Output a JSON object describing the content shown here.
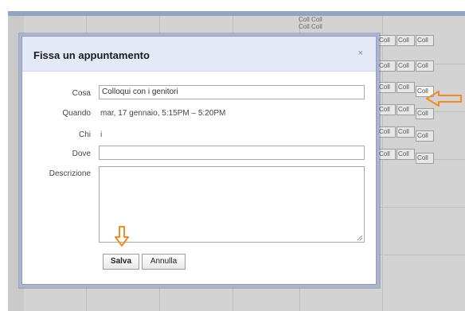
{
  "calendar": {
    "event_label": "Coll",
    "event_strip": [
      "Coll Coll",
      "Coll Coll"
    ],
    "time_labels": [
      "",
      "",
      "",
      "",
      "",
      "",
      ""
    ]
  },
  "dialog": {
    "title": "Fissa un appuntamento",
    "close_label": "×",
    "fields": {
      "cosa_label": "Cosa",
      "cosa_value": "Colloqui con i genitori",
      "quando_label": "Quando",
      "quando_value": "mar, 17 gennaio, 5:15PM – 5:20PM",
      "chi_label": "Chi",
      "chi_value": "i",
      "dove_label": "Dove",
      "dove_value": "",
      "descrizione_label": "Descrizione",
      "descrizione_value": ""
    },
    "buttons": {
      "save_label": "Salva",
      "cancel_label": "Annulla"
    }
  },
  "annotations": {
    "arrow_color": "#f08a24",
    "arrow_down_icon": "arrow-down-icon",
    "arrow_left_icon": "arrow-left-icon"
  }
}
